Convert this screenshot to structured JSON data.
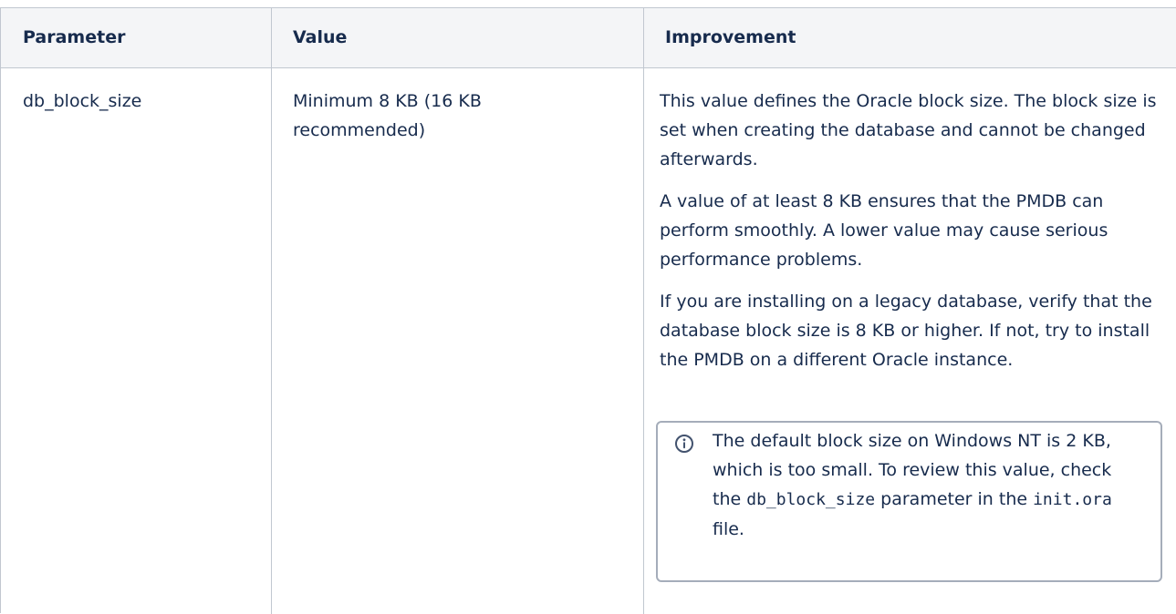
{
  "table": {
    "headers": {
      "parameter": "Parameter",
      "value": "Value",
      "improvement": "Improvement"
    },
    "rows": [
      {
        "parameter": "db_block_size",
        "value_line1": "Minimum 8 KB (16 KB",
        "value_line2": "recommended)",
        "improvement": {
          "p1": "This value defines the Oracle block size. The block size is set when creating the database and cannot be changed afterwards.",
          "p2": "A value of at least 8 KB ensures that the PMDB can perform smoothly. A lower value may cause serious performance problems.",
          "p3": "If you are installing on a legacy database, verify that the database block size is 8 KB or higher. If not, try to install the PMDB on a different Oracle instance.",
          "note": {
            "text_before": "The default block size on Windows NT is 2 KB, which is too small. To review this value, check the ",
            "code1": "db_block_size",
            "text_middle": " parameter in the ",
            "code2": "init.ora",
            "text_after": " file."
          }
        }
      }
    ]
  },
  "icons": {
    "note_icon": "info-circle-icon"
  },
  "colors": {
    "text": "#172b4d",
    "header_bg": "#f4f5f7",
    "border": "#c1c7d0",
    "panel_border": "#a5adba"
  }
}
